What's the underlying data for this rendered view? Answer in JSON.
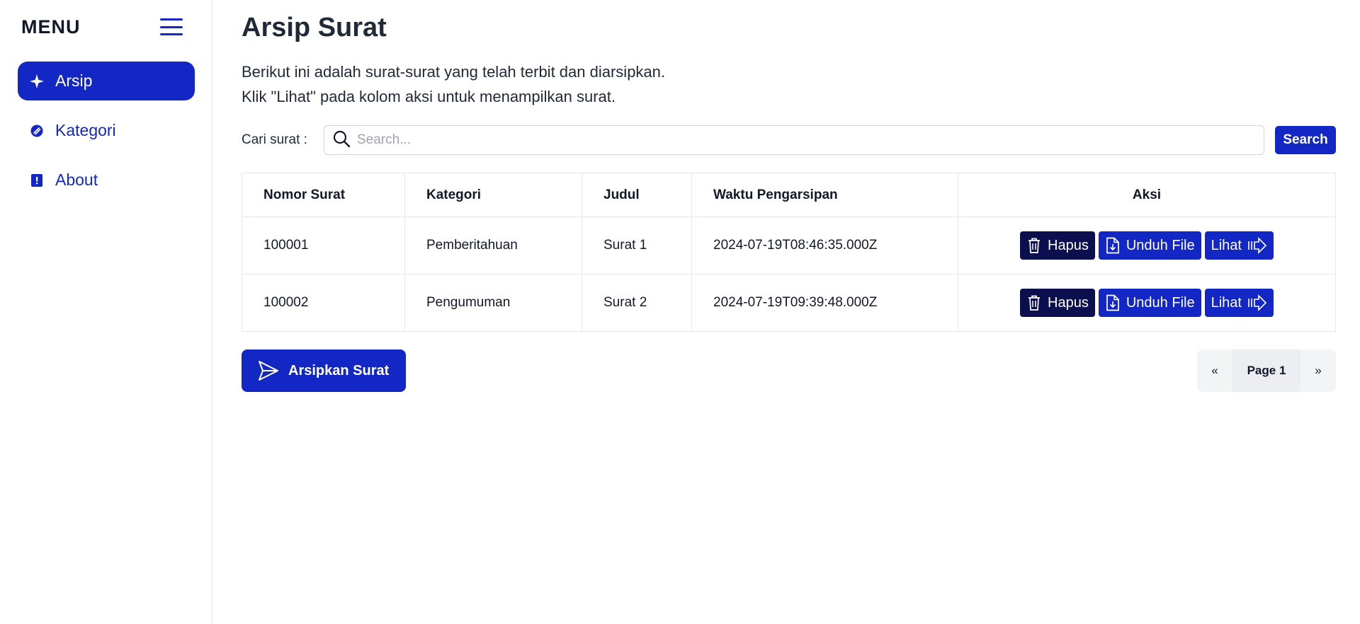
{
  "sidebar": {
    "title": "MENU",
    "items": [
      {
        "label": "Arsip",
        "icon": "sparkle-icon",
        "active": true
      },
      {
        "label": "Kategori",
        "icon": "tag-icon",
        "active": false
      },
      {
        "label": "About",
        "icon": "info-icon",
        "active": false
      }
    ]
  },
  "main": {
    "title": "Arsip Surat",
    "description_line1": "Berikut ini adalah surat-surat yang telah terbit dan diarsipkan.",
    "description_line2": "Klik \"Lihat\" pada kolom aksi untuk menampilkan surat.",
    "search": {
      "label": "Cari surat :",
      "placeholder": "Search...",
      "value": "",
      "button_label": "Search"
    },
    "table": {
      "headers": [
        "Nomor Surat",
        "Kategori",
        "Judul",
        "Waktu Pengarsipan",
        "Aksi"
      ],
      "rows": [
        {
          "nomor": "100001",
          "kategori": "Pemberitahuan",
          "judul": "Surat 1",
          "waktu": "2024-07-19T08:46:35.000Z"
        },
        {
          "nomor": "100002",
          "kategori": "Pengumuman",
          "judul": "Surat 2",
          "waktu": "2024-07-19T09:39:48.000Z"
        }
      ],
      "actions": {
        "delete": "Hapus",
        "download": "Unduh File",
        "view": "Lihat"
      }
    },
    "archive_button": "Arsipkan Surat",
    "pagination": {
      "prev": "«",
      "current": "Page 1",
      "next": "»"
    }
  },
  "colors": {
    "primary": "#1327c4",
    "dark": "#0b0f4d",
    "text": "#1f2937"
  }
}
